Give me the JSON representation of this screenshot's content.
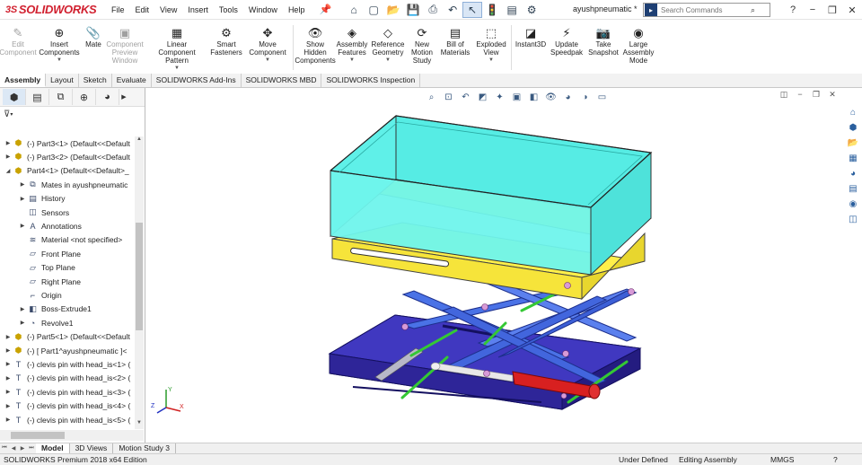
{
  "app": {
    "brand": "SOLIDWORKS",
    "doc_title": "ayushpneumatic *"
  },
  "menu": [
    "File",
    "Edit",
    "View",
    "Insert",
    "Tools",
    "Window",
    "Help"
  ],
  "search": {
    "placeholder": "Search Commands"
  },
  "ribbon": [
    {
      "label": "Edit Component",
      "icon": "edit-component-icon",
      "glyph": "✎",
      "disabled": true
    },
    {
      "label": "Insert Components",
      "icon": "insert-components-icon",
      "glyph": "⊕",
      "disabled": false,
      "caret": true
    },
    {
      "label": "Mate",
      "icon": "mate-icon",
      "glyph": "📎",
      "disabled": false
    },
    {
      "label": "Component Preview Window",
      "icon": "component-preview-icon",
      "glyph": "▣",
      "disabled": true
    },
    {
      "label": "Linear Component Pattern",
      "icon": "linear-pattern-icon",
      "glyph": "▦",
      "disabled": false,
      "caret": true
    },
    {
      "label": "Smart Fasteners",
      "icon": "smart-fasteners-icon",
      "glyph": "⚙",
      "disabled": false
    },
    {
      "label": "Move Component",
      "icon": "move-component-icon",
      "glyph": "✥",
      "disabled": false,
      "caret": true
    },
    {
      "label": "Show Hidden Components",
      "icon": "show-hidden-icon",
      "glyph": "👁",
      "disabled": false
    },
    {
      "label": "Assembly Features",
      "icon": "assembly-features-icon",
      "glyph": "◈",
      "disabled": false,
      "caret": true
    },
    {
      "label": "Reference Geometry",
      "icon": "reference-geometry-icon",
      "glyph": "◇",
      "disabled": false,
      "caret": true
    },
    {
      "label": "New Motion Study",
      "icon": "motion-study-icon",
      "glyph": "⟳",
      "disabled": false
    },
    {
      "label": "Bill of Materials",
      "icon": "bom-icon",
      "glyph": "▤",
      "disabled": false
    },
    {
      "label": "Exploded View",
      "icon": "exploded-view-icon",
      "glyph": "⬚",
      "disabled": false,
      "caret": true
    },
    {
      "label": "Instant3D",
      "icon": "instant3d-icon",
      "glyph": "◪",
      "disabled": false
    },
    {
      "label": "Update Speedpak",
      "icon": "speedpak-icon",
      "glyph": "⚡",
      "disabled": false
    },
    {
      "label": "Take Snapshot",
      "icon": "snapshot-icon",
      "glyph": "📷",
      "disabled": false
    },
    {
      "label": "Large Assembly Mode",
      "icon": "large-assembly-icon",
      "glyph": "◉",
      "disabled": false
    }
  ],
  "command_tabs": [
    "Assembly",
    "Layout",
    "Sketch",
    "Evaluate",
    "SOLIDWORKS Add-Ins",
    "SOLIDWORKS MBD",
    "SOLIDWORKS Inspection"
  ],
  "tree": [
    {
      "label": "(-) Part3<1> (Default<<Default",
      "icon": "part-icon",
      "glyph": "⬢",
      "level": 0,
      "tw": "▶"
    },
    {
      "label": "(-) Part3<2> (Default<<Default",
      "icon": "part-icon",
      "glyph": "⬢",
      "level": 0,
      "tw": "▶"
    },
    {
      "label": "Part4<1> (Default<<Default>_",
      "icon": "part-icon",
      "glyph": "⬢",
      "level": 0,
      "tw": "◢"
    },
    {
      "label": "Mates in ayushpneumatic",
      "icon": "mates-folder-icon",
      "glyph": "⧉",
      "level": 1,
      "tw": "▶"
    },
    {
      "label": "History",
      "icon": "history-icon",
      "glyph": "▤",
      "level": 1,
      "tw": "▶"
    },
    {
      "label": "Sensors",
      "icon": "sensors-icon",
      "glyph": "◫",
      "level": 1,
      "tw": ""
    },
    {
      "label": "Annotations",
      "icon": "annotations-icon",
      "glyph": "A",
      "level": 1,
      "tw": "▶"
    },
    {
      "label": "Material <not specified>",
      "icon": "material-icon",
      "glyph": "≋",
      "level": 1,
      "tw": ""
    },
    {
      "label": "Front Plane",
      "icon": "plane-icon",
      "glyph": "▱",
      "level": 1,
      "tw": ""
    },
    {
      "label": "Top Plane",
      "icon": "plane-icon",
      "glyph": "▱",
      "level": 1,
      "tw": ""
    },
    {
      "label": "Right Plane",
      "icon": "plane-icon",
      "glyph": "▱",
      "level": 1,
      "tw": ""
    },
    {
      "label": "Origin",
      "icon": "origin-icon",
      "glyph": "⌐",
      "level": 1,
      "tw": ""
    },
    {
      "label": "Boss-Extrude1",
      "icon": "boss-extrude-icon",
      "glyph": "◧",
      "level": 1,
      "tw": "▶"
    },
    {
      "label": "Revolve1",
      "icon": "revolve-icon",
      "glyph": "◔",
      "level": 1,
      "tw": "▶"
    },
    {
      "label": "(-) Part5<1> (Default<<Default",
      "icon": "part-icon",
      "glyph": "⬢",
      "level": 0,
      "tw": "▶"
    },
    {
      "label": "(-) [ Part1^ayushpneumatic ]<",
      "icon": "part-icon",
      "glyph": "⬢",
      "level": 0,
      "tw": "▶"
    },
    {
      "label": "(-) clevis pin with head_is<1> (",
      "icon": "clevis-pin-icon",
      "glyph": "T",
      "level": 0,
      "tw": "▶"
    },
    {
      "label": "(-) clevis pin with head_is<2> (",
      "icon": "clevis-pin-icon",
      "glyph": "T",
      "level": 0,
      "tw": "▶"
    },
    {
      "label": "(-) clevis pin with head_is<3> (",
      "icon": "clevis-pin-icon",
      "glyph": "T",
      "level": 0,
      "tw": "▶"
    },
    {
      "label": "(-) clevis pin with head_is<4> (",
      "icon": "clevis-pin-icon",
      "glyph": "T",
      "level": 0,
      "tw": "▶"
    },
    {
      "label": "(-) clevis pin with head_is<5> (",
      "icon": "clevis-pin-icon",
      "glyph": "T",
      "level": 0,
      "tw": "▶"
    }
  ],
  "model_tabs": [
    "Model",
    "3D Views",
    "Motion Study 3"
  ],
  "status": {
    "edition": "SOLIDWORKS Premium 2018 x64 Edition",
    "state": "Under Defined",
    "mode": "Editing Assembly",
    "units": "MMGS"
  },
  "triad": {
    "x": "X",
    "y": "Y",
    "z": "Z"
  },
  "colors": {
    "brand": "#d1202f",
    "tray": "#5ff0e8",
    "platform": "#fff04a",
    "scissor": "#4a72e6",
    "base": "#3a2fb0",
    "cylinder": "#d82020",
    "pin": "#3cc83c"
  }
}
